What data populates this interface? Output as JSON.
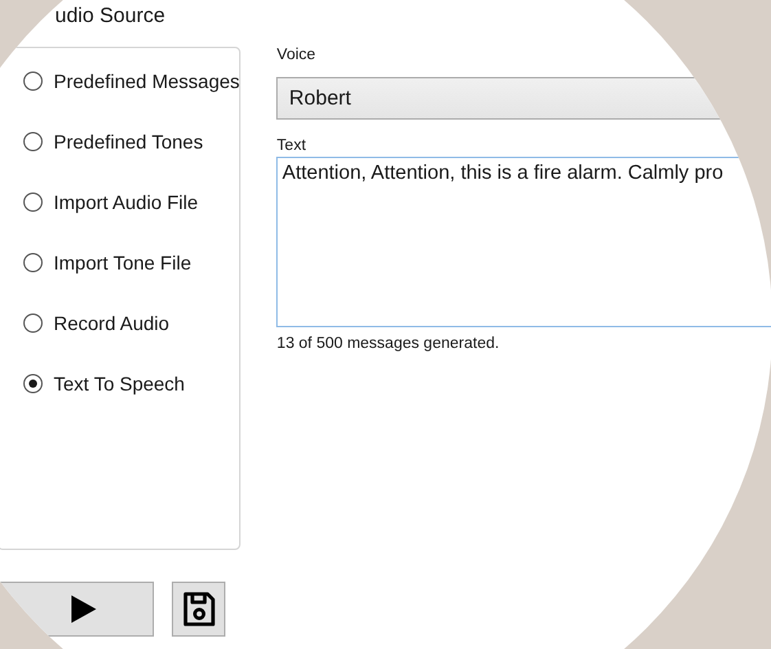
{
  "section_title": "udio Source",
  "audio_sources": [
    {
      "label": "Predefined Messages",
      "selected": false
    },
    {
      "label": "Predefined Tones",
      "selected": false
    },
    {
      "label": "Import Audio File",
      "selected": false
    },
    {
      "label": "Import Tone File",
      "selected": false
    },
    {
      "label": "Record Audio",
      "selected": false
    },
    {
      "label": "Text To Speech",
      "selected": true
    }
  ],
  "voice": {
    "label": "Voice",
    "value": "Robert"
  },
  "text": {
    "label": "Text",
    "value": "Attention, Attention, this is a fire alarm. Calmly pro"
  },
  "status": "13 of 500 messages generated.",
  "buttons": [
    {
      "kind": "play"
    },
    {
      "kind": "save"
    }
  ]
}
